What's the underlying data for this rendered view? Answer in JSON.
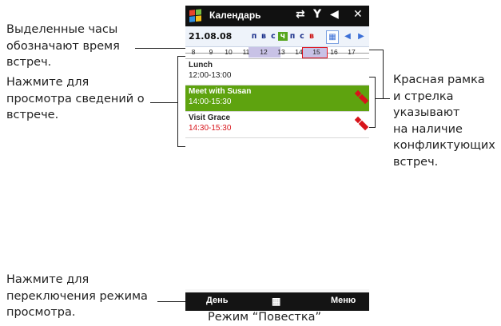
{
  "annotations": {
    "highlighted_hours": [
      "Выделенные часы",
      "обозначают время",
      "встреч."
    ],
    "tap_details": [
      "Нажмите для",
      "просмотра сведений о",
      "встрече."
    ],
    "conflict": [
      "Красная рамка",
      "и стрелка",
      "указывают",
      "на наличие",
      "конфликтующих",
      "встреч."
    ],
    "switch_view": [
      "Нажмите для",
      "переключения режима",
      "просмотра."
    ],
    "caption": "Режим “Повестка”"
  },
  "phone": {
    "title": "Календарь",
    "status_icons": [
      "sync-icon",
      "signal-icon",
      "volume-icon",
      "close-icon"
    ],
    "date": "21.08.08",
    "days": [
      "п",
      "в",
      "с",
      "ч",
      "п",
      "с",
      "в"
    ],
    "today_index": 3,
    "hours": [
      "8",
      "9",
      "10",
      "11",
      "12",
      "13",
      "14",
      "15",
      "16",
      "17"
    ],
    "appointments": [
      {
        "subject": "Lunch",
        "time": "12:00-13:00",
        "selected": false,
        "conflict": false
      },
      {
        "subject": "Meet with Susan",
        "time": "14:00-15:30",
        "selected": true,
        "conflict": true
      },
      {
        "subject": "Visit Grace",
        "time": "14:30-15:30",
        "selected": false,
        "conflict": true
      }
    ],
    "softkeys": {
      "left": "День",
      "right": "Меню"
    },
    "colors": {
      "selected_bg": "#5ea30f",
      "conflict_red": "#d8141a",
      "highlight_band": "#c8c2e6",
      "today_bg": "#55a51d"
    }
  }
}
